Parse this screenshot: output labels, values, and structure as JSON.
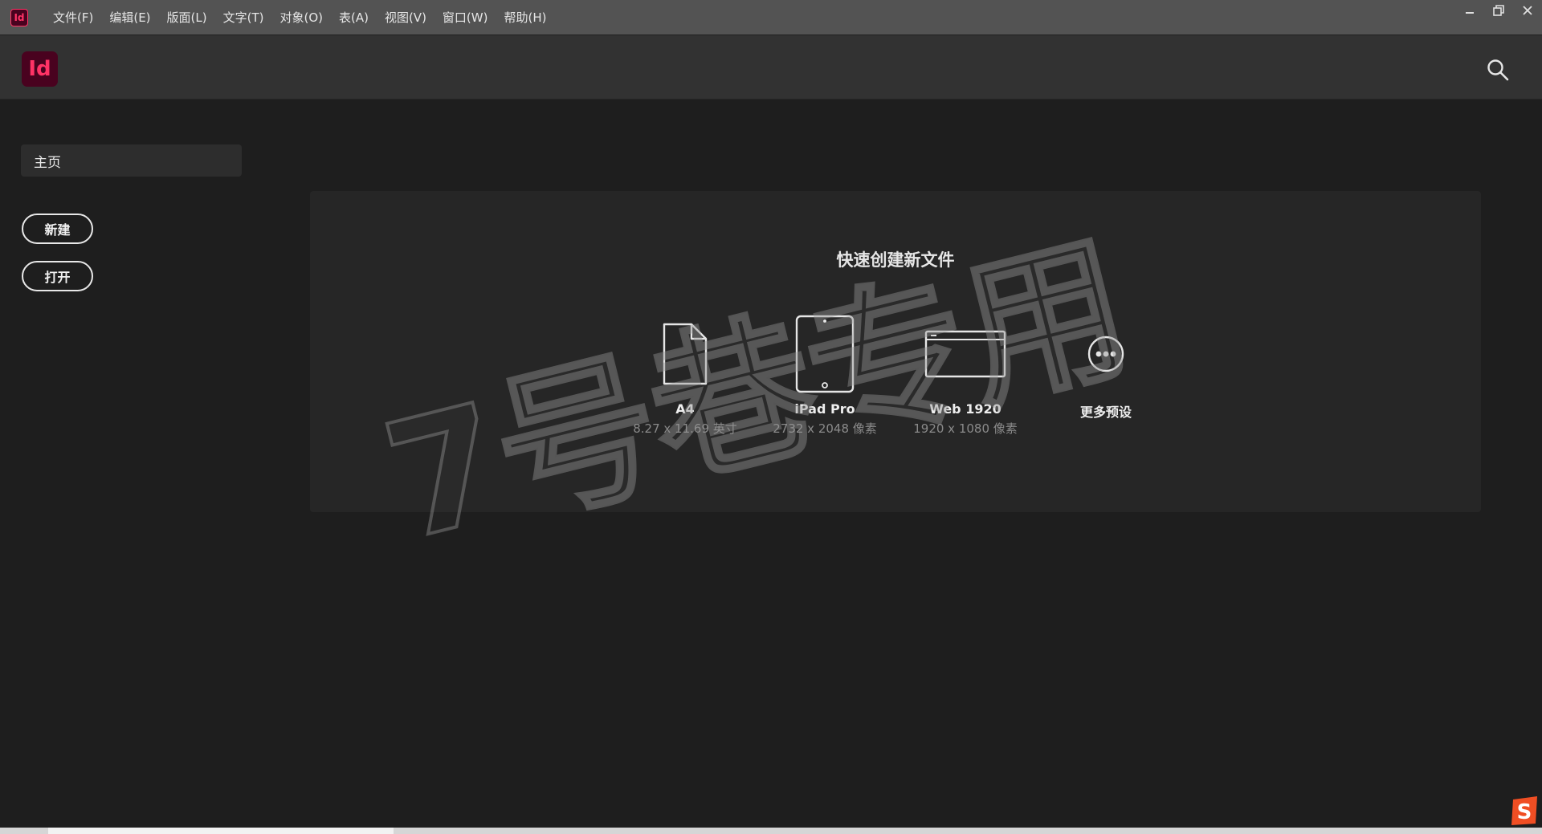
{
  "titlebar": {
    "app_icon_text": "Id",
    "menu": [
      "文件(F)",
      "编辑(E)",
      "版面(L)",
      "文字(T)",
      "对象(O)",
      "表(A)",
      "视图(V)",
      "窗口(W)",
      "帮助(H)"
    ]
  },
  "header": {
    "logo_text": "Id",
    "search_icon": "search-icon"
  },
  "sidebar": {
    "home_label": "主页",
    "new_label": "新建",
    "open_label": "打开"
  },
  "quick_create": {
    "title": "快速创建新文件",
    "presets": [
      {
        "name": "A4",
        "dims": "8.27 x 11.69 英寸",
        "icon": "document-icon"
      },
      {
        "name": "iPad Pro",
        "dims": "2732 x 2048 像素",
        "icon": "tablet-icon"
      },
      {
        "name": "Web 1920",
        "dims": "1920 x 1080 像素",
        "icon": "browser-window-icon"
      },
      {
        "name": "更多预设",
        "dims": "",
        "icon": "more-icon"
      }
    ]
  },
  "watermark": {
    "text": "7号巷专用"
  },
  "colors": {
    "brand": "#ff3366",
    "brand_bg": "#49021f",
    "background": "#1e1e1e",
    "card": "#262626"
  }
}
